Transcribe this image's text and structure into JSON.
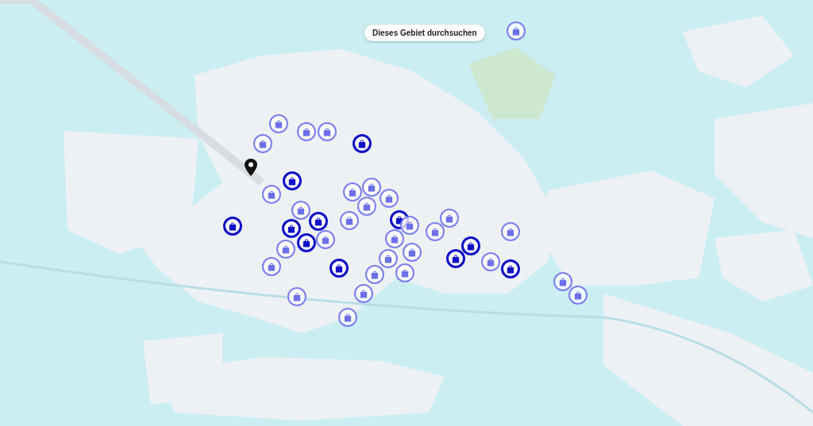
{
  "search_button": {
    "label": "Dieses Gebiet durchsuchen"
  },
  "location_pin": {
    "shown": true
  },
  "markers": [
    {
      "highlighted": false
    },
    {
      "highlighted": false
    },
    {
      "highlighted": false
    },
    {
      "highlighted": false
    },
    {
      "highlighted": false
    },
    {
      "highlighted": true
    },
    {
      "highlighted": true
    },
    {
      "highlighted": false
    },
    {
      "highlighted": false
    },
    {
      "highlighted": false
    },
    {
      "highlighted": false
    },
    {
      "highlighted": false
    },
    {
      "highlighted": true
    },
    {
      "highlighted": true
    },
    {
      "highlighted": true
    },
    {
      "highlighted": true
    },
    {
      "highlighted": false
    },
    {
      "highlighted": false
    },
    {
      "highlighted": false
    },
    {
      "highlighted": true
    },
    {
      "highlighted": false
    },
    {
      "highlighted": false
    },
    {
      "highlighted": false
    },
    {
      "highlighted": false
    },
    {
      "highlighted": false
    },
    {
      "highlighted": false
    },
    {
      "highlighted": false
    },
    {
      "highlighted": true
    },
    {
      "highlighted": false
    },
    {
      "highlighted": false
    },
    {
      "highlighted": false
    },
    {
      "highlighted": false
    },
    {
      "highlighted": false
    },
    {
      "highlighted": false
    },
    {
      "highlighted": true
    },
    {
      "highlighted": true
    },
    {
      "highlighted": false
    },
    {
      "highlighted": false
    },
    {
      "highlighted": true
    },
    {
      "highlighted": false
    },
    {
      "highlighted": false
    }
  ]
}
